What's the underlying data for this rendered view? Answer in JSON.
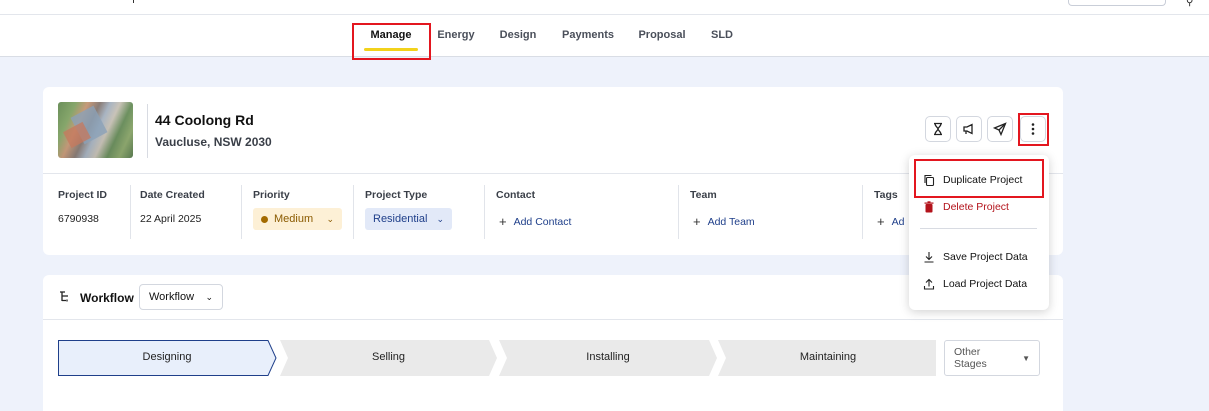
{
  "tabs": [
    {
      "label": "Manage",
      "active": true
    },
    {
      "label": "Energy"
    },
    {
      "label": "Design"
    },
    {
      "label": "Payments"
    },
    {
      "label": "Proposal"
    },
    {
      "label": "SLD"
    }
  ],
  "project": {
    "address_line1": "44 Coolong Rd",
    "address_line2": "Vaucluse, NSW 2030",
    "actions": [
      "hourglass-icon",
      "megaphone-icon",
      "send-icon",
      "more-vertical-icon"
    ]
  },
  "details": {
    "project_id_label": "Project ID",
    "project_id_value": "6790938",
    "date_label": "Date Created",
    "date_value": "22 April 2025",
    "priority_label": "Priority",
    "priority_value": "Medium",
    "type_label": "Project Type",
    "type_value": "Residential",
    "contact_label": "Contact",
    "contact_action": "Add Contact",
    "team_label": "Team",
    "team_action": "Add Team",
    "tags_label": "Tags",
    "tags_action": "Ad"
  },
  "workflow": {
    "title": "Workflow",
    "select_value": "Workflow",
    "stages": [
      "Designing",
      "Selling",
      "Installing",
      "Maintaining"
    ],
    "active_stage": "Designing",
    "other_stages_label": "Other Stages"
  },
  "menu": {
    "items": [
      {
        "label": "Duplicate Project",
        "icon": "copy-icon"
      },
      {
        "label": "Delete Project",
        "icon": "trash-icon",
        "danger": true
      },
      {
        "label": "Save Project Data",
        "icon": "download-icon"
      },
      {
        "label": "Load Project Data",
        "icon": "upload-icon"
      }
    ]
  },
  "colors": {
    "accent_underline": "#f2d21b",
    "highlight_box": "#e3161f",
    "danger": "#b3131b",
    "active_stage_fill": "#e8effb",
    "active_stage_border": "#1f3f8a",
    "stage_fill": "#eaeaea"
  }
}
